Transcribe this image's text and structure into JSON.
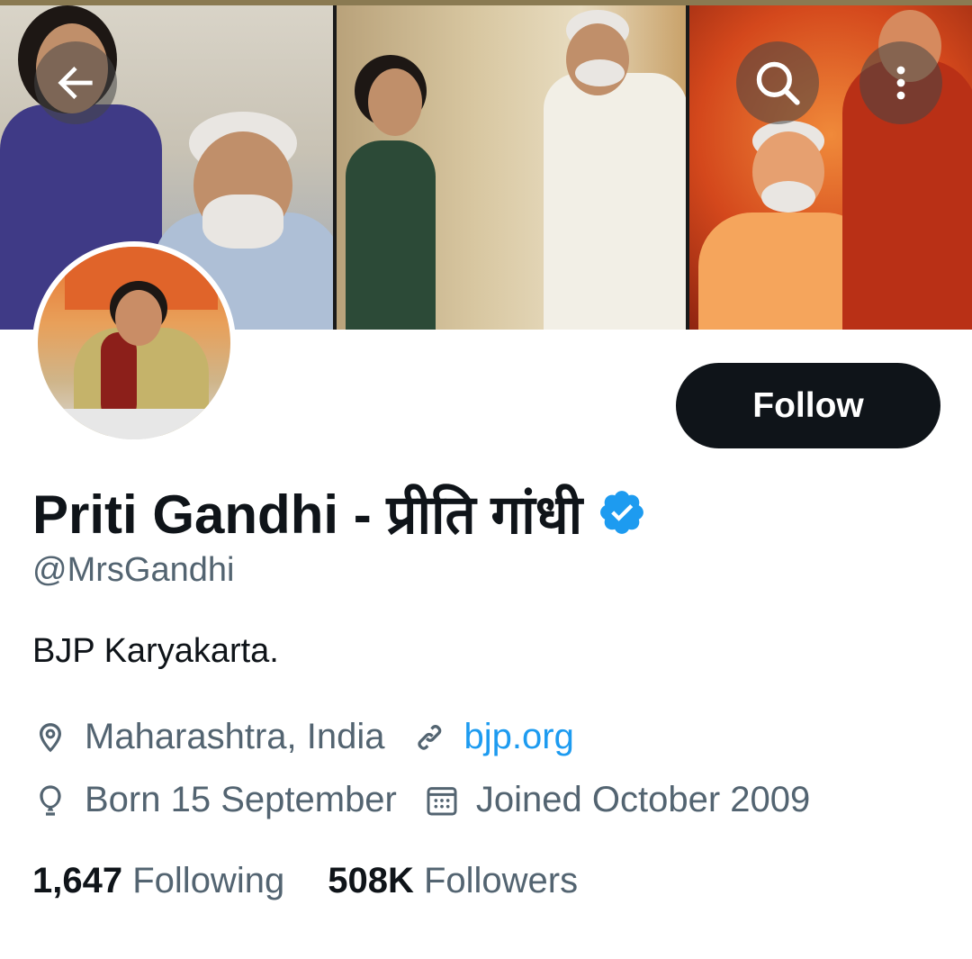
{
  "header": {
    "back_icon": "arrow-left-icon",
    "search_icon": "search-icon",
    "more_icon": "more-vertical-icon"
  },
  "profile": {
    "name": "Priti Gandhi - प्रीति गांधी",
    "verified_icon": "verified-badge-icon",
    "handle": "@MrsGandhi",
    "bio": "BJP Karyakarta.",
    "follow_label": "Follow",
    "location": "Maharashtra, India",
    "website": "bjp.org",
    "birthday": "Born 15 September",
    "joined": "Joined October 2009"
  },
  "stats": {
    "following_count": "1,647",
    "following_label": "Following",
    "followers_count": "508K",
    "followers_label": "Followers"
  },
  "colors": {
    "follow_bg": "#0f1419",
    "link": "#1d9bf0",
    "verified": "#1d9bf0",
    "secondary_text": "#536471"
  }
}
